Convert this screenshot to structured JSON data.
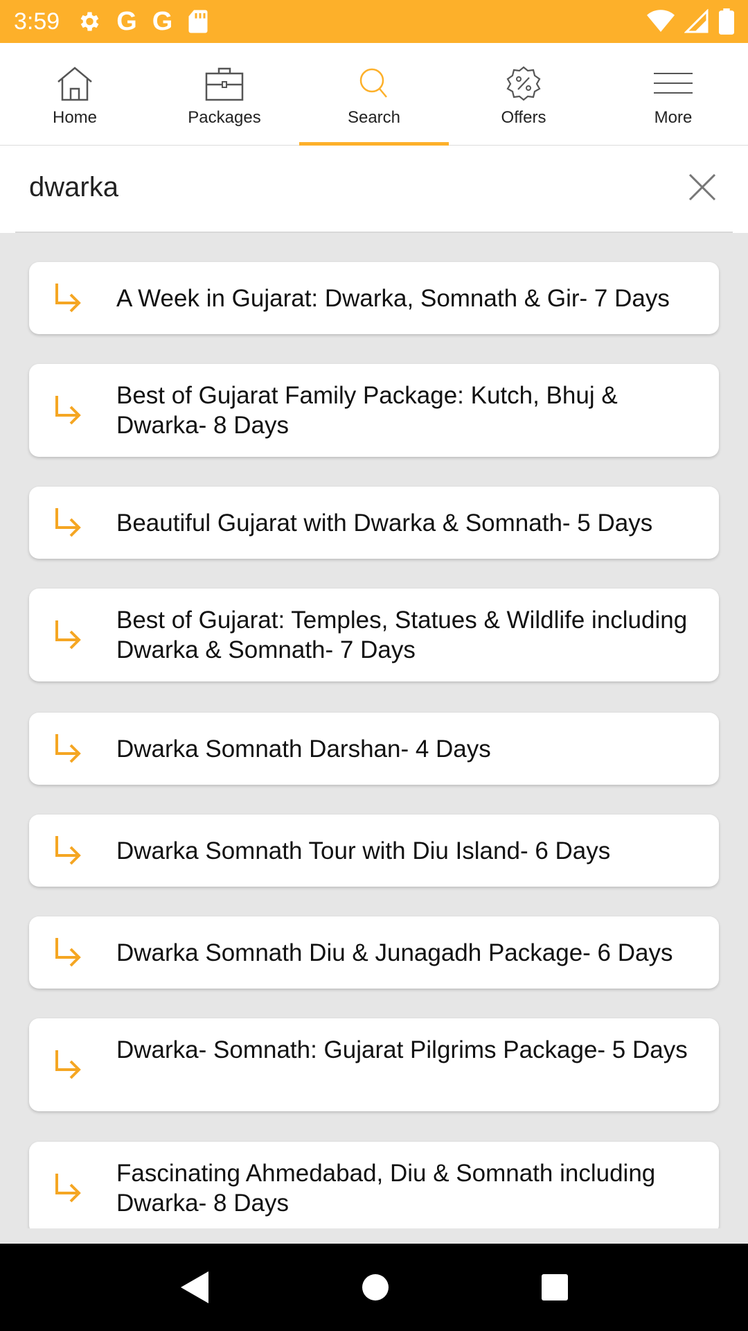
{
  "status_bar": {
    "time": "3:59",
    "left_icons": [
      "settings-icon",
      "google-icon",
      "google-icon",
      "sd-card-icon"
    ],
    "right_icons": [
      "wifi-icon",
      "signal-icon",
      "battery-icon"
    ],
    "g1": "G",
    "g2": "G"
  },
  "top_nav": {
    "accent_color": "#fdb02a",
    "tabs": [
      {
        "label": "Home",
        "icon": "home-icon",
        "active": false
      },
      {
        "label": "Packages",
        "icon": "briefcase-icon",
        "active": false
      },
      {
        "label": "Search",
        "icon": "search-icon",
        "active": true
      },
      {
        "label": "Offers",
        "icon": "discount-badge-icon",
        "active": false
      },
      {
        "label": "More",
        "icon": "menu-icon",
        "active": false
      }
    ]
  },
  "search": {
    "value": "dwarka",
    "clear_icon": "close-icon"
  },
  "results": [
    {
      "title": "A Week in Gujarat: Dwarka, Somnath & Gir- 7 Days"
    },
    {
      "title": "Best of Gujarat Family Package: Kutch, Bhuj & Dwarka- 8 Days"
    },
    {
      "title": "Beautiful Gujarat with Dwarka & Somnath- 5 Days"
    },
    {
      "title": "Best of Gujarat: Temples, Statues & Wildlife including Dwarka & Somnath- 7 Days"
    },
    {
      "title": "Dwarka Somnath Darshan- 4 Days"
    },
    {
      "title": "Dwarka Somnath Tour with Diu Island- 6 Days"
    },
    {
      "title": "Dwarka Somnath Diu & Junagadh Package- 6 Days"
    },
    {
      "title": "Dwarka- Somnath: Gujarat Pilgrims Package- 5 Days"
    },
    {
      "title": "Fascinating Ahmedabad, Diu & Somnath including Dwarka- 8 Days"
    }
  ],
  "result_icon": "arrow-right-down-icon",
  "android_nav": {
    "icons": [
      "back-icon",
      "home-circle-icon",
      "recents-icon"
    ]
  }
}
